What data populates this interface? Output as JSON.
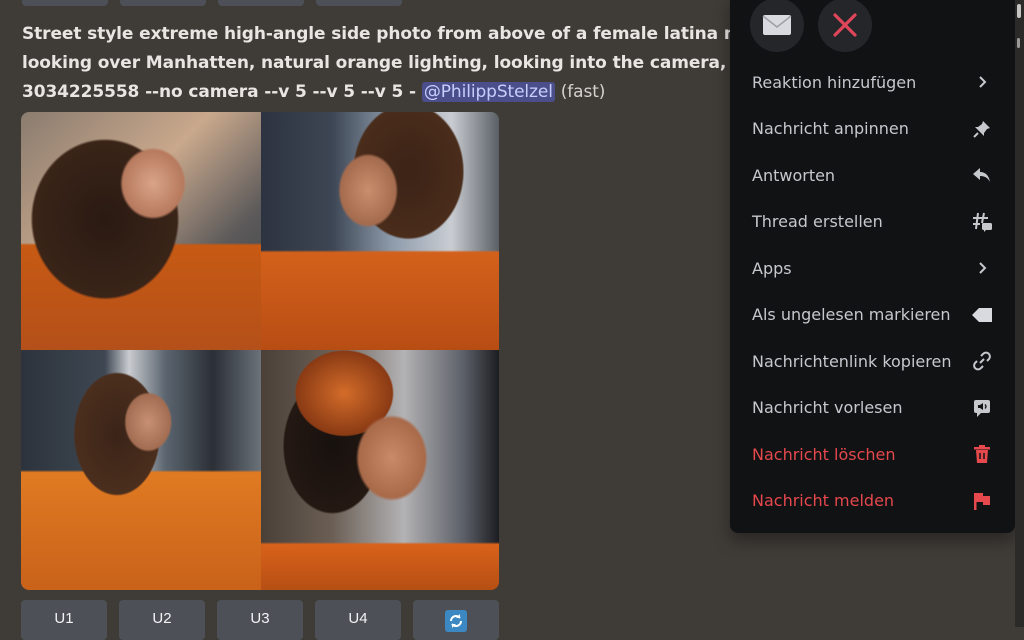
{
  "message": {
    "prompt_lines": [
      "Street style extreme high-angle side photo from above of a female latina m",
      "looking over Manhatten, natural orange lighting, looking into the camera,",
      "3034225558 --no camera --v 5 --v 5 --v 5 - "
    ],
    "mention": "@PhilippStelzel",
    "mode": "(fast)",
    "image_alt": "Grid of four AI-generated portraits of a woman in an orange jacket above Manhattan"
  },
  "action_buttons": [
    {
      "label": "U1"
    },
    {
      "label": "U2"
    },
    {
      "label": "U3"
    },
    {
      "label": "U4"
    },
    {
      "label": "",
      "icon": "reroll-icon"
    }
  ],
  "context_menu": {
    "quick_reactions": [
      {
        "icon": "envelope-icon",
        "glyph": "✉"
      },
      {
        "icon": "cross-mark-icon",
        "glyph": "✕"
      }
    ],
    "items": [
      {
        "label": "Reaktion hinzufügen",
        "icon": "chevron-right-icon",
        "danger": false
      },
      {
        "label": "Nachricht anpinnen",
        "icon": "pin-icon",
        "danger": false
      },
      {
        "label": "Antworten",
        "icon": "reply-icon",
        "danger": false
      },
      {
        "label": "Thread erstellen",
        "icon": "thread-icon",
        "danger": false
      },
      {
        "label": "Apps",
        "icon": "chevron-right-icon",
        "danger": false
      },
      {
        "label": "Als ungelesen markieren",
        "icon": "mark-unread-icon",
        "danger": false
      },
      {
        "label": "Nachrichtenlink kopieren",
        "icon": "link-icon",
        "danger": false
      },
      {
        "label": "Nachricht vorlesen",
        "icon": "speak-message-icon",
        "danger": false
      },
      {
        "label": "Nachricht löschen",
        "icon": "trash-icon",
        "danger": true
      },
      {
        "label": "Nachricht melden",
        "icon": "flag-icon",
        "danger": true
      }
    ]
  },
  "colors": {
    "background": "#3f3b37",
    "menu_bg": "#111214",
    "danger": "#e5484d",
    "mention_bg": "#4a4f8c",
    "button_bg": "#4e5058",
    "reroll_blue": "#3b88c3"
  }
}
